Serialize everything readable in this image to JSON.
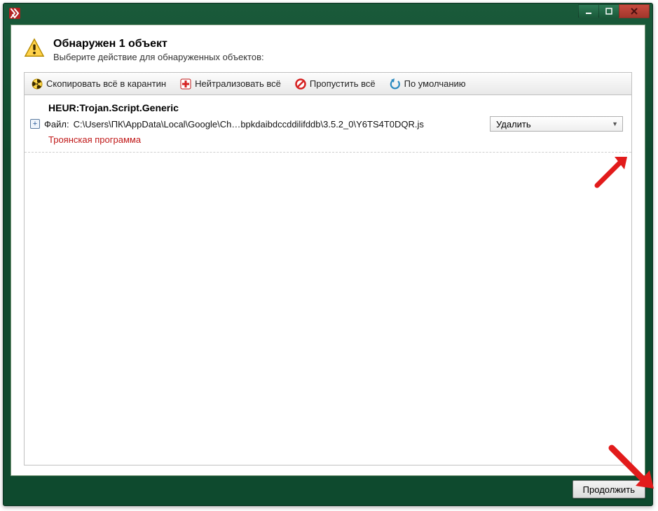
{
  "window": {
    "title": ""
  },
  "header": {
    "title": "Обнаружен 1 объект",
    "subtitle": "Выберите действие для обнаруженных объектов:"
  },
  "toolbar": {
    "quarantine_all": "Скопировать всё в карантин",
    "neutralize_all": "Нейтрализовать всё",
    "skip_all": "Пропустить всё",
    "defaults": "По умолчанию"
  },
  "list": {
    "items": [
      {
        "threat_name": "HEUR:Trojan.Script.Generic",
        "file_label": "Файл:",
        "file_path": "C:\\Users\\ПК\\AppData\\Local\\Google\\Ch…bpkdaibdccddilifddb\\3.5.2_0\\Y6TS4T0DQR.js",
        "action_selected": "Удалить",
        "verdict": "Троянская программа"
      }
    ]
  },
  "footer": {
    "continue_label": "Продолжить"
  },
  "icons": {
    "app": "kaspersky-k",
    "hazard": "warning-triangle",
    "quarantine": "radiation",
    "neutralize": "red-cross",
    "skip": "forbidden",
    "defaults": "undo",
    "expander": "+"
  },
  "colors": {
    "window_bg": "#0e4a2e",
    "danger_text": "#c01818",
    "close_btn": "#c94b3f"
  }
}
